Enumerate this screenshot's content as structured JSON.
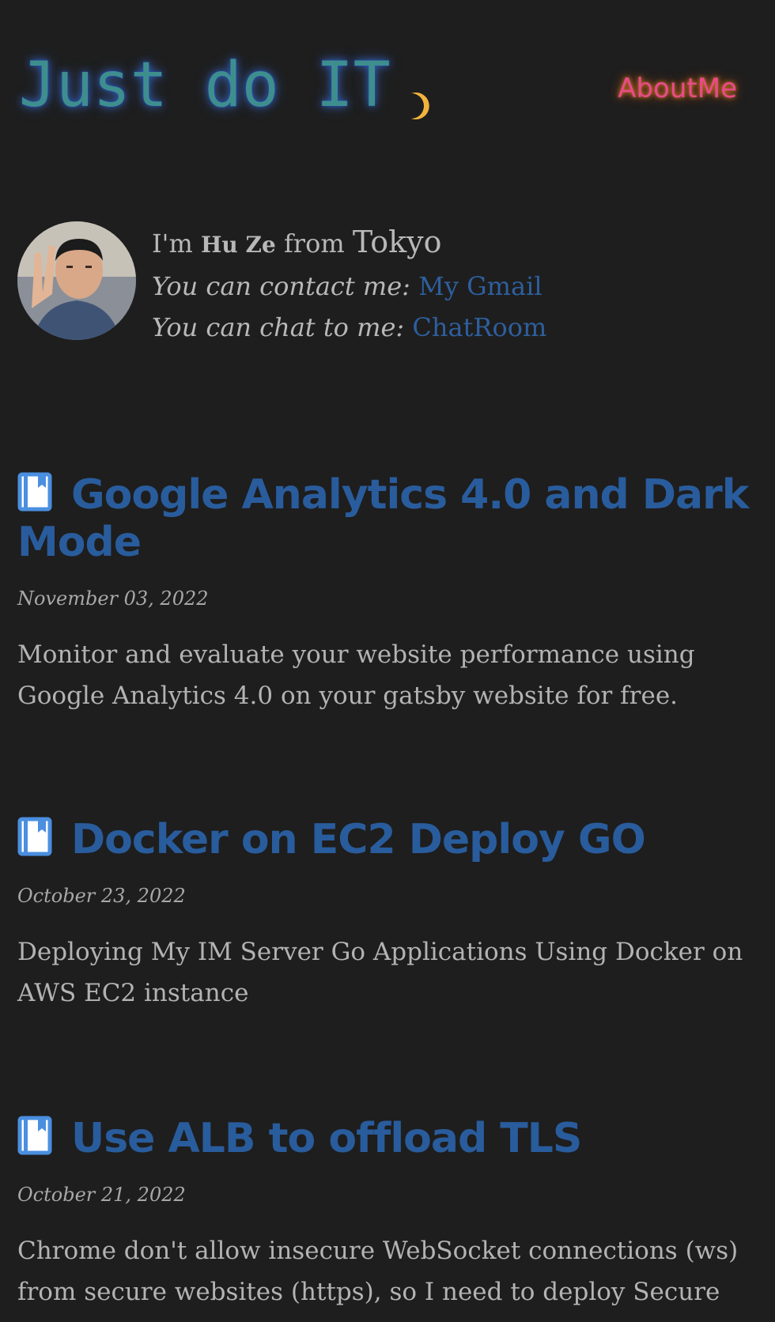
{
  "header": {
    "title": "Just do IT",
    "about_label": "AboutMe",
    "theme_icon": "moon-icon"
  },
  "bio": {
    "prefix": "I'm",
    "name": "Hu Ze",
    "from": "from",
    "city": "Tokyo",
    "contact_label": "You can contact me:",
    "contact_link": "My Gmail",
    "chat_label": "You can chat to me:",
    "chat_link": "ChatRoom"
  },
  "posts": [
    {
      "title": "Google Analytics 4.0 and Dark Mode",
      "date": "November 03, 2022",
      "excerpt": "Monitor and evaluate your website performance using Google Analytics 4.0 on your gatsby website for free."
    },
    {
      "title": "Docker on EC2 Deploy GO",
      "date": "October 23, 2022",
      "excerpt": "Deploying My IM Server Go Applications Using Docker on AWS EC2 instance"
    },
    {
      "title": "Use ALB to offload TLS",
      "date": "October 21, 2022",
      "excerpt": "Chrome don't allow insecure WebSocket connections (ws) from secure websites (https), so I need to deploy Secure"
    }
  ],
  "colors": {
    "background": "#1e1e1e",
    "title_teal": "#3e8e8e",
    "about_pink": "#e94a8b",
    "moon": "#f2b33d",
    "link_blue": "#295c9c",
    "icon_blue": "#4a8fe0"
  }
}
